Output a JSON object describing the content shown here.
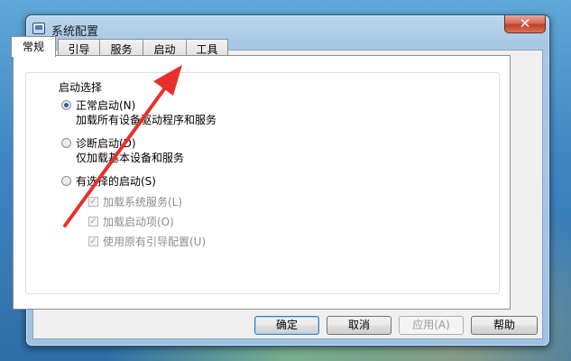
{
  "window": {
    "title": "系统配置",
    "close_label": "✕"
  },
  "tabs": [
    {
      "label": "常规"
    },
    {
      "label": "引导"
    },
    {
      "label": "服务"
    },
    {
      "label": "启动"
    },
    {
      "label": "工具"
    }
  ],
  "startup_group": {
    "label": "启动选择",
    "normal": {
      "label": "正常启动(N)",
      "description": "加载所有设备驱动程序和服务",
      "selected": true
    },
    "diagnostic": {
      "label": "诊断启动(D)",
      "description": "仅加载基本设备和服务",
      "selected": false
    },
    "selective": {
      "label": "有选择的启动(S)",
      "selected": false,
      "options": [
        {
          "label": "加载系统服务(L)",
          "checked": true
        },
        {
          "label": "加载启动项(O)",
          "checked": true
        },
        {
          "label": "使用原有引导配置(U)",
          "checked": true
        }
      ]
    }
  },
  "buttons": {
    "ok": "确定",
    "cancel": "取消",
    "apply": "应用(A)",
    "help": "帮助"
  },
  "annotation": {
    "color": "#e8302a"
  }
}
